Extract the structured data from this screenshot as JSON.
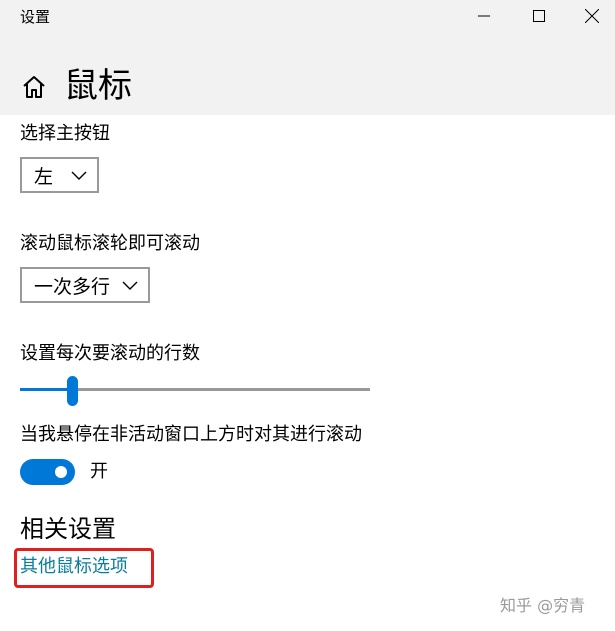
{
  "window": {
    "title": "设置",
    "buttons": [
      "minimize-icon",
      "maximize-icon",
      "close-icon"
    ]
  },
  "page": {
    "title": "鼠标",
    "home_icon": "home-icon"
  },
  "primary_button": {
    "label": "选择主按钮",
    "value": "左"
  },
  "scroll_wheel": {
    "label": "滚动鼠标滚轮即可滚动",
    "value": "一次多行"
  },
  "scroll_lines": {
    "label": "设置每次要滚动的行数",
    "slider_fraction": 0.15
  },
  "inactive_scroll": {
    "label": "当我悬停在非活动窗口上方时对其进行滚动",
    "state": "开"
  },
  "related": {
    "heading": "相关设置",
    "link": "其他鼠标选项"
  },
  "watermark": "知乎 @穷青",
  "colors": {
    "accent": "#0078d7",
    "link": "#0a7d9e",
    "highlight": "#e0201e"
  }
}
